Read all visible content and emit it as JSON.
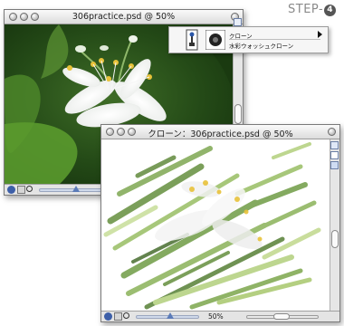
{
  "step_label": "STEP-",
  "step_number": "4",
  "window1": {
    "title": "306practice.psd @ 50%"
  },
  "window2": {
    "title": "クローン：306practice.psd @ 50%",
    "zoom": "50%"
  },
  "popup": {
    "item1": "クローン",
    "item2": "水彩ウォッシュクローン"
  },
  "colors": {
    "accent": "#5b7bb8",
    "photo_bg": "#2f5a1e",
    "flower_white": "#f4f4f4",
    "stamen_yellow": "#e8c23a"
  }
}
